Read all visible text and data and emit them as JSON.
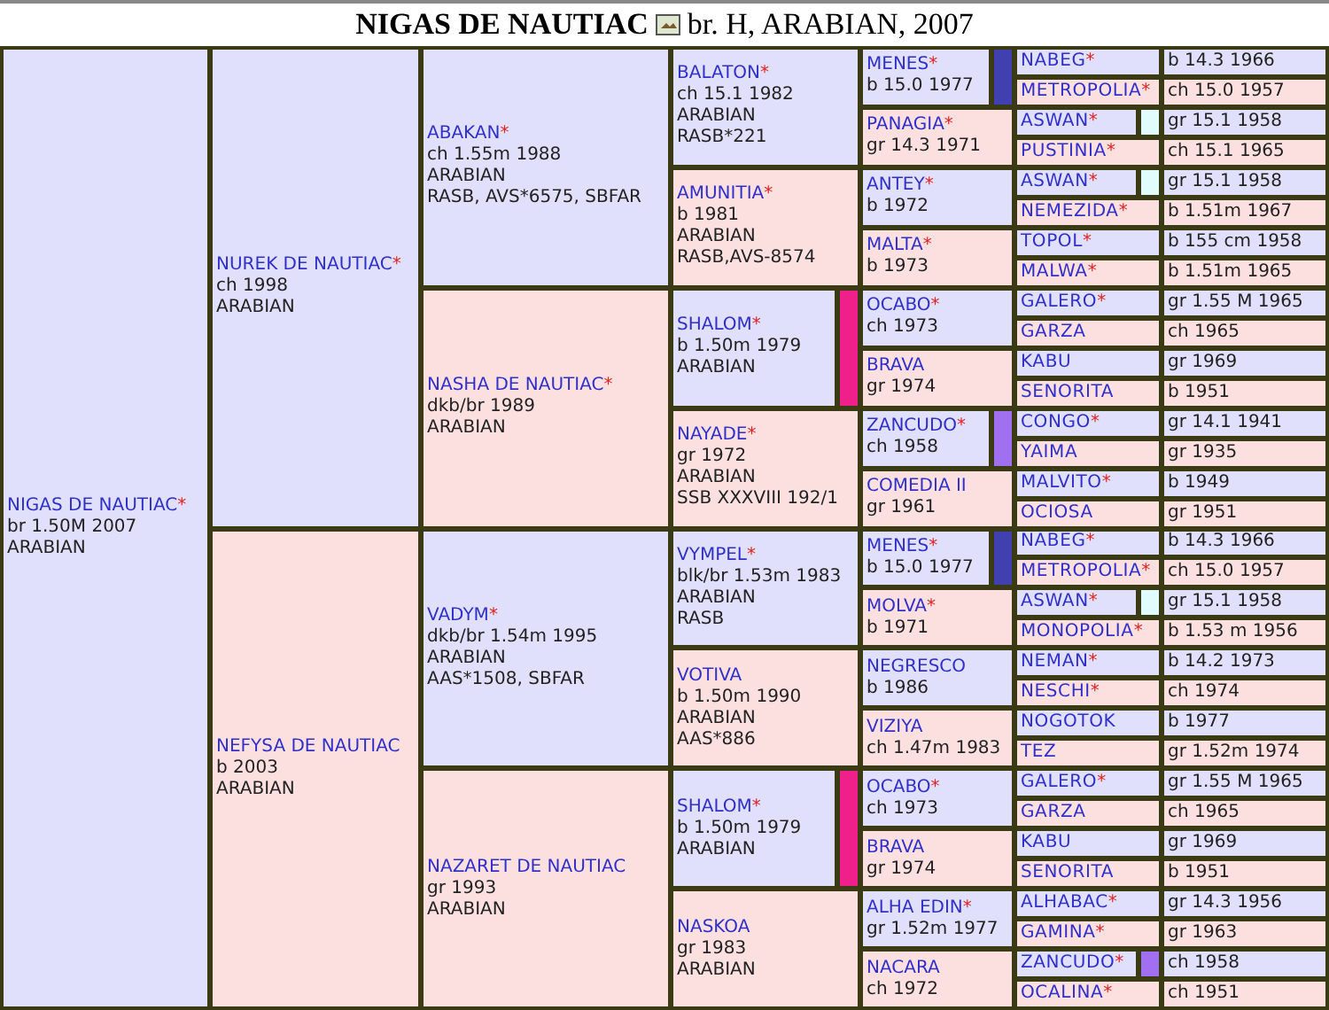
{
  "header": {
    "name": "NIGAS DE NAUTIAC",
    "details": "br. H, ARABIAN, 2007"
  },
  "pedigree": {
    "name": "NIGAS DE NAUTIAC",
    "mark": "*",
    "kind": "sire",
    "lines": [
      "br 1.50M 2007",
      "ARABIAN"
    ],
    "children": [
      {
        "name": "NUREK DE NAUTIAC",
        "mark": "*",
        "kind": "sire",
        "lines": [
          "ch 1998",
          "ARABIAN"
        ],
        "children": [
          {
            "name": "ABAKAN",
            "mark": "*",
            "kind": "sire",
            "lines": [
              "ch 1.55m 1988",
              "ARABIAN",
              "RASB, AVS*6575, SBFAR"
            ],
            "children": [
              {
                "name": "BALATON",
                "mark": "*",
                "kind": "sire",
                "lines": [
                  "ch 15.1 1982",
                  "ARABIAN",
                  "RASB*221"
                ],
                "children": [
                  {
                    "name": "MENES",
                    "mark": "*",
                    "kind": "sire",
                    "color": "#4040b0",
                    "lines": [
                      "b 15.0 1977"
                    ],
                    "children": [
                      {
                        "name": "NABEG",
                        "mark": "*",
                        "kind": "sire",
                        "lines": [
                          "b 14.3 1966"
                        ]
                      },
                      {
                        "name": "METROPOLIA",
                        "mark": "*",
                        "kind": "dam",
                        "lines": [
                          "ch 15.0 1957"
                        ]
                      }
                    ]
                  },
                  {
                    "name": "PANAGIA",
                    "mark": "*",
                    "kind": "dam",
                    "lines": [
                      "gr 14.3 1971"
                    ],
                    "children": [
                      {
                        "name": "ASWAN",
                        "mark": "*",
                        "kind": "sire",
                        "color": "#e0fcfc",
                        "lines": [
                          "gr 15.1 1958"
                        ]
                      },
                      {
                        "name": "PUSTINIA",
                        "mark": "*",
                        "kind": "dam",
                        "lines": [
                          "ch 15.1 1965"
                        ]
                      }
                    ]
                  }
                ]
              },
              {
                "name": "AMUNITIA",
                "mark": "*",
                "kind": "dam",
                "lines": [
                  "b 1981",
                  "ARABIAN",
                  "RASB,AVS-8574"
                ],
                "children": [
                  {
                    "name": "ANTEY",
                    "mark": "*",
                    "kind": "sire",
                    "lines": [
                      "b 1972"
                    ],
                    "children": [
                      {
                        "name": "ASWAN",
                        "mark": "*",
                        "kind": "sire",
                        "color": "#e0fcfc",
                        "lines": [
                          "gr 15.1 1958"
                        ]
                      },
                      {
                        "name": "NEMEZIDA",
                        "mark": "*",
                        "kind": "dam",
                        "lines": [
                          "b 1.51m 1967"
                        ]
                      }
                    ]
                  },
                  {
                    "name": "MALTA",
                    "mark": "*",
                    "kind": "dam",
                    "lines": [
                      "b 1973"
                    ],
                    "children": [
                      {
                        "name": "TOPOL",
                        "mark": "*",
                        "kind": "sire",
                        "lines": [
                          "b 155 cm 1958"
                        ]
                      },
                      {
                        "name": "MALWA",
                        "mark": "*",
                        "kind": "dam",
                        "lines": [
                          "b 1.51m 1965"
                        ]
                      }
                    ]
                  }
                ]
              }
            ]
          },
          {
            "name": "NASHA DE NAUTIAC",
            "mark": "*",
            "kind": "dam",
            "lines": [
              "dkb/br 1989",
              "ARABIAN"
            ],
            "children": [
              {
                "name": "SHALOM",
                "mark": "*",
                "kind": "sire",
                "color": "#f0208a",
                "lines": [
                  "b 1.50m 1979",
                  "ARABIAN"
                ],
                "children": [
                  {
                    "name": "OCABO",
                    "mark": "*",
                    "kind": "sire",
                    "lines": [
                      "ch 1973"
                    ],
                    "children": [
                      {
                        "name": "GALERO",
                        "mark": "*",
                        "kind": "sire",
                        "lines": [
                          "gr 1.55 M 1965"
                        ]
                      },
                      {
                        "name": "GARZA",
                        "kind": "dam",
                        "lines": [
                          "ch 1965"
                        ]
                      }
                    ]
                  },
                  {
                    "name": "BRAVA",
                    "kind": "dam",
                    "lines": [
                      "gr 1974"
                    ],
                    "children": [
                      {
                        "name": "KABU",
                        "kind": "sire",
                        "lines": [
                          "gr 1969"
                        ]
                      },
                      {
                        "name": "SENORITA",
                        "kind": "dam",
                        "lines": [
                          "b 1951"
                        ]
                      }
                    ]
                  }
                ]
              },
              {
                "name": "NAYADE",
                "mark": "*",
                "kind": "dam",
                "lines": [
                  "gr 1972",
                  "ARABIAN",
                  "SSB XXXVIII 192/1"
                ],
                "children": [
                  {
                    "name": "ZANCUDO",
                    "mark": "*",
                    "kind": "sire",
                    "color": "#a070f0",
                    "lines": [
                      "ch 1958"
                    ],
                    "children": [
                      {
                        "name": "CONGO",
                        "mark": "*",
                        "kind": "sire",
                        "lines": [
                          "gr 14.1 1941"
                        ]
                      },
                      {
                        "name": "YAIMA",
                        "kind": "dam",
                        "lines": [
                          "gr 1935"
                        ]
                      }
                    ]
                  },
                  {
                    "name": "COMEDIA II",
                    "kind": "dam",
                    "lines": [
                      "gr 1961"
                    ],
                    "children": [
                      {
                        "name": "MALVITO",
                        "mark": "*",
                        "kind": "sire",
                        "lines": [
                          "b 1949"
                        ]
                      },
                      {
                        "name": "OCIOSA",
                        "kind": "dam",
                        "lines": [
                          "gr 1951"
                        ]
                      }
                    ]
                  }
                ]
              }
            ]
          }
        ]
      },
      {
        "name": "NEFYSA DE NAUTIAC",
        "kind": "dam",
        "lines": [
          "b 2003",
          "ARABIAN"
        ],
        "children": [
          {
            "name": "VADYM",
            "mark": "*",
            "kind": "sire",
            "lines": [
              "dkb/br 1.54m 1995",
              "ARABIAN",
              "AAS*1508, SBFAR"
            ],
            "children": [
              {
                "name": "VYMPEL",
                "mark": "*",
                "kind": "sire",
                "lines": [
                  "blk/br 1.53m 1983",
                  "ARABIAN",
                  "RASB"
                ],
                "children": [
                  {
                    "name": "MENES",
                    "mark": "*",
                    "kind": "sire",
                    "color": "#4040b0",
                    "lines": [
                      "b 15.0 1977"
                    ],
                    "children": [
                      {
                        "name": "NABEG",
                        "mark": "*",
                        "kind": "sire",
                        "lines": [
                          "b 14.3 1966"
                        ]
                      },
                      {
                        "name": "METROPOLIA",
                        "mark": "*",
                        "kind": "dam",
                        "lines": [
                          "ch 15.0 1957"
                        ]
                      }
                    ]
                  },
                  {
                    "name": "MOLVA",
                    "mark": "*",
                    "kind": "dam",
                    "lines": [
                      "b 1971"
                    ],
                    "children": [
                      {
                        "name": "ASWAN",
                        "mark": "*",
                        "kind": "sire",
                        "color": "#e0fcfc",
                        "lines": [
                          "gr 15.1 1958"
                        ]
                      },
                      {
                        "name": "MONOPOLIA",
                        "mark": "*",
                        "kind": "dam",
                        "lines": [
                          "b 1.53 m 1956"
                        ]
                      }
                    ]
                  }
                ]
              },
              {
                "name": "VOTIVA",
                "kind": "dam",
                "lines": [
                  "b 1.50m 1990",
                  "ARABIAN",
                  "AAS*886"
                ],
                "children": [
                  {
                    "name": "NEGRESCO",
                    "kind": "sire",
                    "lines": [
                      "b 1986"
                    ],
                    "children": [
                      {
                        "name": "NEMAN",
                        "mark": "*",
                        "kind": "sire",
                        "lines": [
                          "b 14.2 1973"
                        ]
                      },
                      {
                        "name": "NESCHI",
                        "mark": "*",
                        "kind": "dam",
                        "lines": [
                          "ch 1974"
                        ]
                      }
                    ]
                  },
                  {
                    "name": "VIZIYA",
                    "kind": "dam",
                    "lines": [
                      "ch 1.47m 1983"
                    ],
                    "children": [
                      {
                        "name": "NOGOTOK",
                        "kind": "sire",
                        "lines": [
                          "b 1977"
                        ]
                      },
                      {
                        "name": "TEZ",
                        "kind": "dam",
                        "lines": [
                          "gr 1.52m 1974"
                        ]
                      }
                    ]
                  }
                ]
              }
            ]
          },
          {
            "name": "NAZARET DE NAUTIAC",
            "kind": "dam",
            "lines": [
              "gr 1993",
              "ARABIAN"
            ],
            "children": [
              {
                "name": "SHALOM",
                "mark": "*",
                "kind": "sire",
                "color": "#f0208a",
                "lines": [
                  "b 1.50m 1979",
                  "ARABIAN"
                ],
                "children": [
                  {
                    "name": "OCABO",
                    "mark": "*",
                    "kind": "sire",
                    "lines": [
                      "ch 1973"
                    ],
                    "children": [
                      {
                        "name": "GALERO",
                        "mark": "*",
                        "kind": "sire",
                        "lines": [
                          "gr 1.55 M 1965"
                        ]
                      },
                      {
                        "name": "GARZA",
                        "kind": "dam",
                        "lines": [
                          "ch 1965"
                        ]
                      }
                    ]
                  },
                  {
                    "name": "BRAVA",
                    "kind": "dam",
                    "lines": [
                      "gr 1974"
                    ],
                    "children": [
                      {
                        "name": "KABU",
                        "kind": "sire",
                        "lines": [
                          "gr 1969"
                        ]
                      },
                      {
                        "name": "SENORITA",
                        "kind": "dam",
                        "lines": [
                          "b 1951"
                        ]
                      }
                    ]
                  }
                ]
              },
              {
                "name": "NASKOA",
                "kind": "dam",
                "lines": [
                  "gr 1983",
                  "ARABIAN"
                ],
                "children": [
                  {
                    "name": "ALHA EDIN",
                    "mark": "*",
                    "kind": "sire",
                    "lines": [
                      "gr 1.52m 1977"
                    ],
                    "children": [
                      {
                        "name": "ALHABAC",
                        "mark": "*",
                        "kind": "sire",
                        "lines": [
                          "gr 14.3 1956"
                        ]
                      },
                      {
                        "name": "GAMINA",
                        "mark": "*",
                        "kind": "dam",
                        "lines": [
                          "gr 1963"
                        ]
                      }
                    ]
                  },
                  {
                    "name": "NACARA",
                    "kind": "dam",
                    "lines": [
                      "ch 1972"
                    ],
                    "children": [
                      {
                        "name": "ZANCUDO",
                        "mark": "*",
                        "kind": "sire",
                        "color": "#a070f0",
                        "lines": [
                          "ch 1958"
                        ]
                      },
                      {
                        "name": "OCALINA",
                        "mark": "*",
                        "kind": "dam",
                        "lines": [
                          "ch 1951"
                        ]
                      }
                    ]
                  }
                ]
              }
            ]
          }
        ]
      }
    ]
  }
}
